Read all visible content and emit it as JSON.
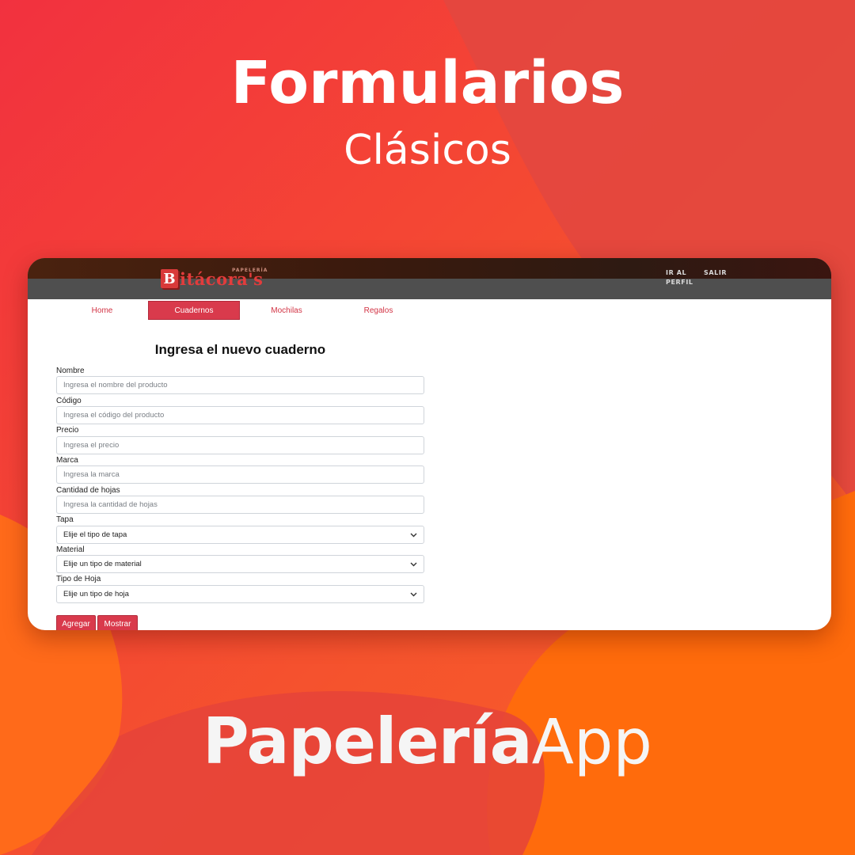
{
  "poster": {
    "headline": "Formularios",
    "subheadline": "Clásicos",
    "brand_bold": "Papelería",
    "brand_light": "App"
  },
  "colors": {
    "background_red": "#f14a35",
    "background_orange": "#ff6a10",
    "accent": "#d93a4c",
    "header_dark": "#4f4f4f"
  },
  "app": {
    "logo": {
      "mark": "B",
      "text": "itácora's",
      "small": "PAPELERÍA"
    },
    "top_links": [
      "IR AL PERFIL",
      "SALIR"
    ],
    "nav_tabs": [
      {
        "label": "Home",
        "active": false
      },
      {
        "label": "Cuadernos",
        "active": true
      },
      {
        "label": "Mochilas",
        "active": false
      },
      {
        "label": "Regalos",
        "active": false
      }
    ]
  },
  "form": {
    "title": "Ingresa el nuevo cuaderno",
    "fields": [
      {
        "label": "Nombre",
        "placeholder": "Ingresa el nombre del producto"
      },
      {
        "label": "Código",
        "placeholder": "Ingresa el código del producto"
      },
      {
        "label": "Precio",
        "placeholder": "Ingresa el precio"
      },
      {
        "label": "Marca",
        "placeholder": "Ingresa la marca"
      },
      {
        "label": "Cantidad de hojas",
        "placeholder": "Ingresa la cantidad de hojas"
      }
    ],
    "selects": [
      {
        "label": "Tapa",
        "value": "Elije el tipo de tapa",
        "icon": "chevron-down-icon"
      },
      {
        "label": "Material",
        "value": "Elije un tipo de material",
        "icon": "chevron-down-icon"
      },
      {
        "label": "Tipo de Hoja",
        "value": "Elije un tipo de hoja",
        "icon": "chevron-down-icon"
      }
    ],
    "buttons": {
      "add": "Agregar",
      "show": "Mostrar"
    }
  }
}
